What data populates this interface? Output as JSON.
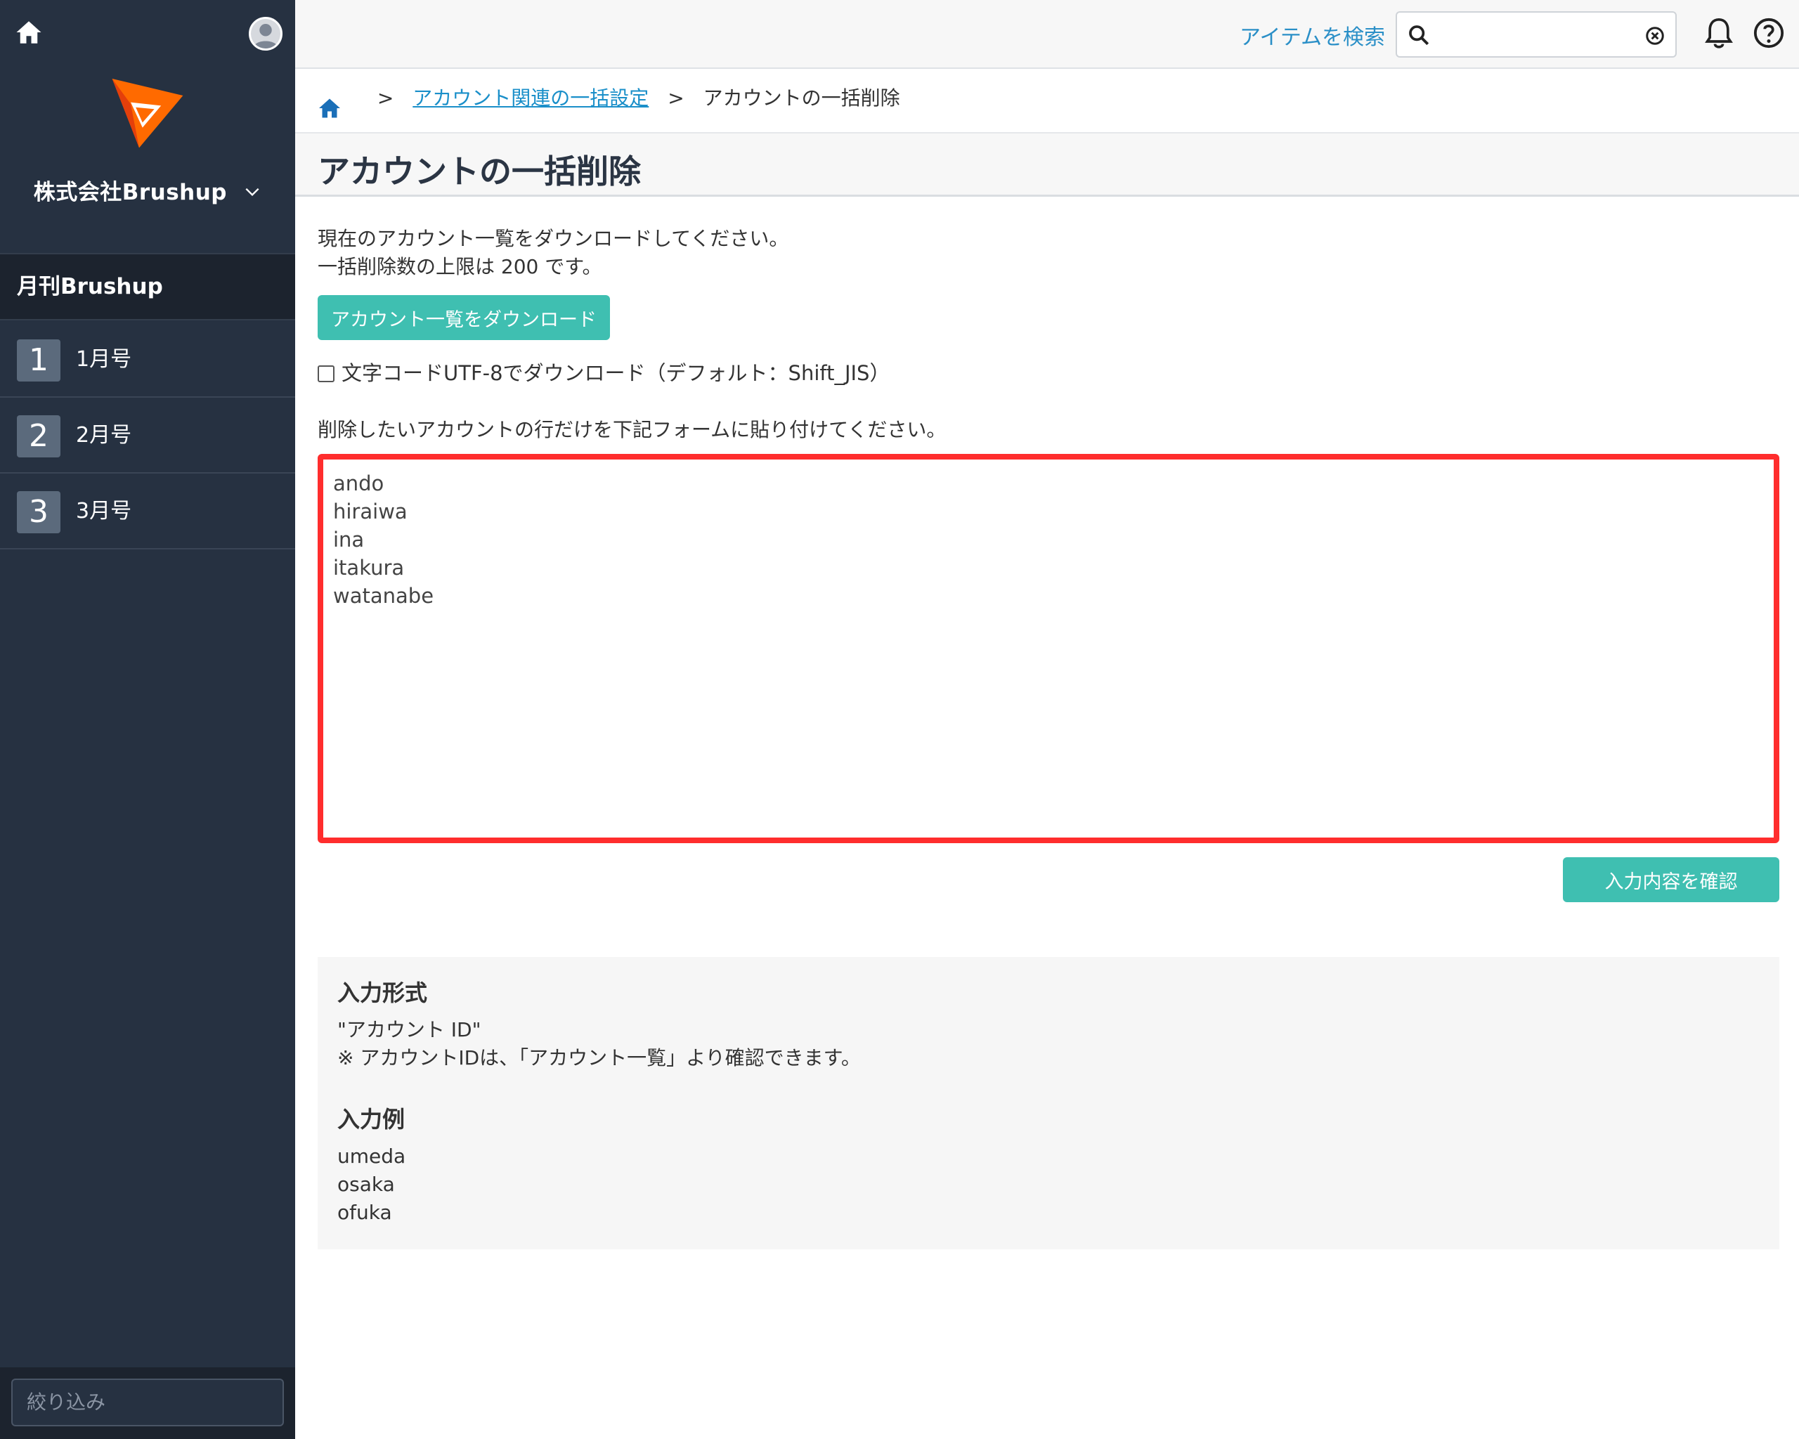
{
  "sidebar": {
    "company": "株式会社Brushup",
    "project": "月刊Brushup",
    "issues": [
      {
        "num": "1",
        "label": "1月号"
      },
      {
        "num": "2",
        "label": "2月号"
      },
      {
        "num": "3",
        "label": "3月号"
      }
    ],
    "filter_placeholder": "絞り込み"
  },
  "header": {
    "search_link": "アイテムを検索"
  },
  "breadcrumb": {
    "link": "アカウント関連の一括設定",
    "current": "アカウントの一括削除",
    "separator": ">"
  },
  "page": {
    "title": "アカウントの一括削除",
    "intro_line1": "現在のアカウント一覧をダウンロードしてください。",
    "intro_line2": "一括削除数の上限は 200 です。",
    "download_button": "アカウント一覧をダウンロード",
    "utf8_checkbox_label": "文字コードUTF-8でダウンロード（デフォルト：Shift_JIS）",
    "utf8_checked": false,
    "paste_instruction": "削除したいアカウントの行だけを下記フォームに貼り付けてください。",
    "textarea_value": "ando\nhiraiwa\nina\nitakura\nwatanabe",
    "confirm_button": "入力内容を確認"
  },
  "info": {
    "format_heading": "入力形式",
    "format_text": "\"アカウント ID\"\n※ アカウントIDは、「アカウント一覧」より確認できます。",
    "example_heading": "入力例",
    "example_text": "umeda\nosaka\nofuka"
  },
  "colors": {
    "sidebar_bg": "#263141",
    "accent": "#3fbfb1",
    "link": "#1a8fc9",
    "highlight": "#ff2d2d",
    "logo": "#ff6a00"
  }
}
